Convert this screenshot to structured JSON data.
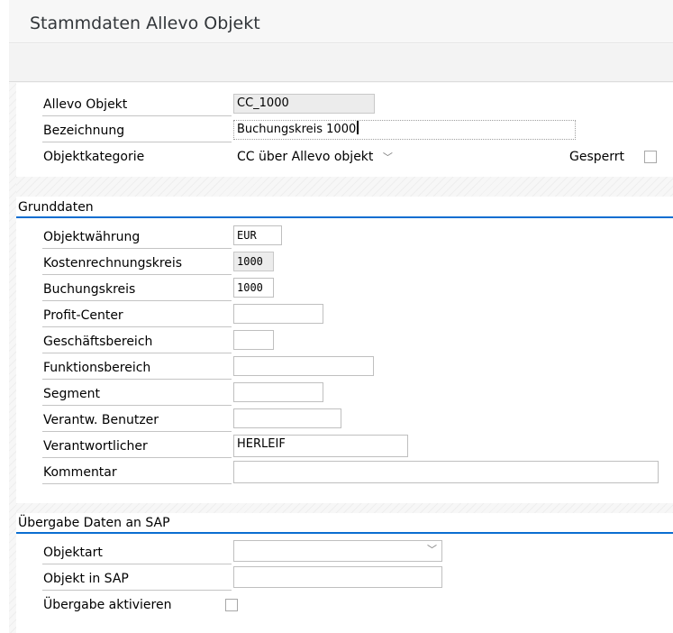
{
  "header": {
    "title": "Stammdaten Allevo Objekt"
  },
  "main": {
    "allevo_objekt": {
      "label": "Allevo Objekt",
      "value": "CC_1000"
    },
    "bezeichnung": {
      "label": "Bezeichnung",
      "value": "Buchungskreis 1000"
    },
    "objektkategorie": {
      "label": "Objektkategorie",
      "value": "CC über Allevo objekt"
    },
    "gesperrt": {
      "label": "Gesperrt",
      "checked": false
    }
  },
  "grunddaten": {
    "title": "Grunddaten",
    "objektwaehrung": {
      "label": "Objektwährung",
      "value": "EUR"
    },
    "kostenrechnungskreis": {
      "label": "Kostenrechnungskreis",
      "value": "1000"
    },
    "buchungskreis": {
      "label": "Buchungskreis",
      "value": "1000"
    },
    "profit_center": {
      "label": "Profit-Center",
      "value": ""
    },
    "geschaeftsbereich": {
      "label": "Geschäftsbereich",
      "value": ""
    },
    "funktionsbereich": {
      "label": "Funktionsbereich",
      "value": ""
    },
    "segment": {
      "label": "Segment",
      "value": ""
    },
    "verantw_benutzer": {
      "label": "Verantw. Benutzer",
      "value": ""
    },
    "verantwortlicher": {
      "label": "Verantwortlicher",
      "value": "HERLEIF"
    },
    "kommentar": {
      "label": "Kommentar",
      "value": ""
    }
  },
  "uebergabe": {
    "title": "Übergabe Daten an SAP",
    "objektart": {
      "label": "Objektart",
      "value": ""
    },
    "objekt_in_sap": {
      "label": "Objekt in SAP",
      "value": ""
    },
    "uebergabe_aktivieren": {
      "label": "Übergabe aktivieren",
      "checked": false
    }
  },
  "icons": {
    "dropdown": "chevron-down-icon"
  },
  "colors": {
    "accent": "#0a6ed1",
    "readonly_bg": "#ececec"
  }
}
